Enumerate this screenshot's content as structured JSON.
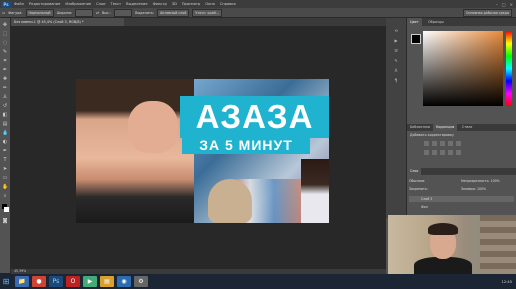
{
  "app": {
    "logo": "Ps"
  },
  "menu": [
    "Файл",
    "Редактирование",
    "Изображение",
    "Слои",
    "Текст",
    "Выделение",
    "Фильтр",
    "3D",
    "Просмотр",
    "Окно",
    "Справка"
  ],
  "window_controls": [
    "–",
    "□",
    "×"
  ],
  "options": {
    "style_label": "Фигура:",
    "style_value": "Нормальный",
    "width_label": "Ширина:",
    "height_label": "Выс.:",
    "refine_label": "Уточн. край...",
    "select_label": "Выделить:",
    "select_value": "Активный слой",
    "workspace": "Основная рабочая среда"
  },
  "document": {
    "tab": "Без имени-1 @ 45,4% (Слой 3, RGB/8) *",
    "status": "45,39%"
  },
  "artwork": {
    "title": "АЗАЗА",
    "subtitle": "ЗА 5 МИНУТ"
  },
  "panels": {
    "color_tabs": [
      "Цвет",
      "Образцы"
    ],
    "adjust_tabs": [
      "Библиотеки",
      "Коррекция",
      "Стили"
    ],
    "adjust_label": "Добавить корректировку",
    "layers_tab": "Слои",
    "layers_rows": [
      {
        "label": "Обычные",
        "value": "Непрозрачность: 100%"
      },
      {
        "label": "Закрепить:",
        "value": "Заливка: 100%"
      },
      {
        "label": "Слой 3",
        "value": ""
      },
      {
        "label": "Фон",
        "value": ""
      }
    ]
  },
  "taskbar": {
    "start_icon": "windows-icon",
    "apps": [
      "explorer",
      "browser",
      "photoshop",
      "opera",
      "media",
      "files",
      "player",
      "tool"
    ],
    "clock": "12:45"
  },
  "colors": {
    "accent": "#1fb3cf",
    "menubar": "#3c3c3c",
    "panel": "#535353"
  }
}
